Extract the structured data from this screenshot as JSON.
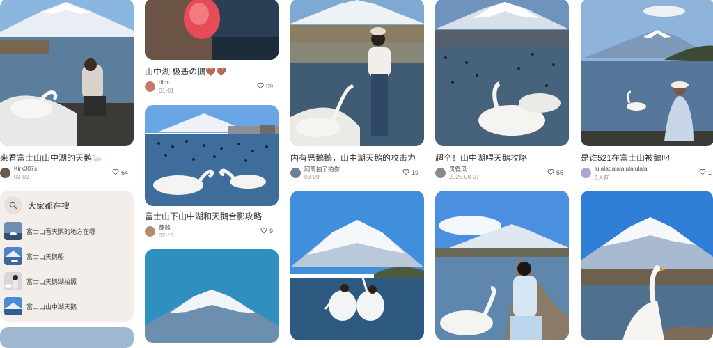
{
  "cards": [
    {
      "title": "来看富士山山中湖的天鹅🦢",
      "author": "Kirk307s",
      "date": "03-09",
      "likes": "64",
      "avatar_color": "#6b5a4e"
    },
    {
      "title": "山中湖 极恶の鵝🤎🤎",
      "author": "dimi",
      "date": "01-01",
      "likes": "59",
      "avatar_color": "#c27a6a"
    },
    {
      "title": "富士山下山中湖和天鹅合影攻略",
      "author": "静酱",
      "date": "02-15",
      "likes": "9",
      "avatar_color": "#b98a6b"
    },
    {
      "title": "内有恶鵝鵝，山中湖天鹅的攻击力",
      "author": "阿周拍了拍你",
      "date": "03-09",
      "likes": "19",
      "avatar_color": "#6d7f95"
    },
    {
      "title": "超全！山中湖喂天鹅攻略",
      "author": "灵得风",
      "date": "2025-08-07",
      "likes": "55",
      "avatar_color": "#8a8a8a"
    },
    {
      "title": "是谁521在富士山被鵝叼",
      "author": "lulaladalalalulalulala",
      "date": "5天前",
      "likes": "1",
      "avatar_color": "#a7a9c9"
    }
  ],
  "search": {
    "title": "大家都在搜",
    "items": [
      {
        "label": "富士山看天鹅的地方在哪"
      },
      {
        "label": "富士山天鹅船"
      },
      {
        "label": "富士山天鹅湖拍照"
      },
      {
        "label": "富士山山中湖天鹅"
      }
    ]
  },
  "colors": {
    "background": "#ffffff",
    "search_panel": "#f3eeea",
    "sky": "#4f8fd8",
    "lake": "#4a6f92"
  },
  "icons": {
    "like": "heart-outline-icon",
    "search": "magnifier-icon"
  }
}
